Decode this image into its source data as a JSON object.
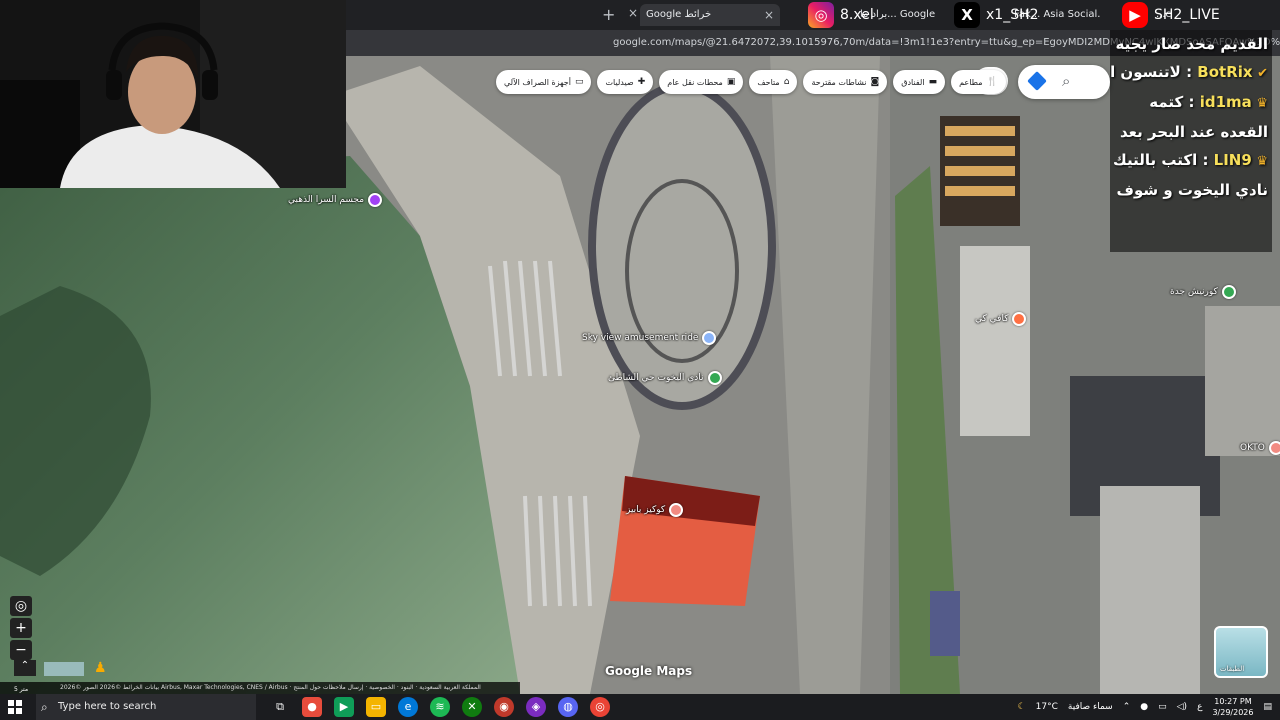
{
  "browser": {
    "tabs": [
      {
        "label": "Google خرائط",
        "active": true
      },
      {
        "label": "براد ما... Google",
        "active": false
      },
      {
        "label": "Fak... Asia Social...",
        "active": false
      },
      {
        "label": "...c",
        "active": false
      }
    ],
    "new_tab": "+",
    "url": "google.com/maps/@21.6472072,39.1015976,70m/data=!3m1!1e3?entry=ttu&g_ep=EgoyMDI2MDMyNC4wIKXMDSoASAFQAw%3D%3D"
  },
  "socials": {
    "instagram": "8.xel",
    "x": "x1_SH2",
    "youtube": "SH2_LIVE"
  },
  "map": {
    "chips": [
      {
        "label": "مطاعم",
        "icon": "fork-knife-icon"
      },
      {
        "label": "الفنادق",
        "icon": "bed-icon"
      },
      {
        "label": "نشاطات مقترحة",
        "icon": "camera-icon"
      },
      {
        "label": "متاحف",
        "icon": "museum-icon"
      },
      {
        "label": "محطات نقل عام",
        "icon": "transit-icon"
      },
      {
        "label": "صيدليات",
        "icon": "pharmacy-icon"
      },
      {
        "label": "أجهزة الصراف الآلي",
        "icon": "atm-icon"
      }
    ],
    "menu_glyph": "ع",
    "pois": [
      {
        "label": "مجسم السرا الذهبي",
        "color": "#a142f4"
      },
      {
        "label": "Sky view amusement ride",
        "color": "#8ab4f8"
      },
      {
        "label": "نادي اليخوت حي الشاطئ",
        "color": "#34a853"
      },
      {
        "label": "كوكيز بابيز",
        "color": "#f28b82"
      },
      {
        "label": "كافي كي",
        "color": "#ff7043"
      },
      {
        "label": "كورنيش جدة",
        "color": "#34a853"
      },
      {
        "label": "OKTO",
        "color": "#f28b82"
      }
    ],
    "layers_label": "الطبقات",
    "logo": "Google Maps",
    "attribution": "بيانات الخرائط ©2026 الصور ©2026 Airbus, Maxar Technologies, CNES / Airbus · المملكة العربية السعودية · البنود · الخصوصية · إرسال ملاحظات حول المنتج",
    "scale": "5 متر"
  },
  "chat": [
    {
      "user": "",
      "message": "القديم محد صار يجيه"
    },
    {
      "user": "BotRix",
      "message": "لاتنسون الفولو"
    },
    {
      "user": "id1ma",
      "message": "كتمه"
    },
    {
      "user": "",
      "message": "القعده عند البحر بعد"
    },
    {
      "user": "LIN9",
      "message": "اكتب بالتيك"
    },
    {
      "user": "",
      "message": "نادي اليخوت و شوف"
    }
  ],
  "taskbar": {
    "search_placeholder": "Type here to search",
    "weather": "سماء صافية",
    "temperature": "17°C",
    "lang": "ع",
    "time": "10:27 PM",
    "date": "3/29/2026"
  }
}
